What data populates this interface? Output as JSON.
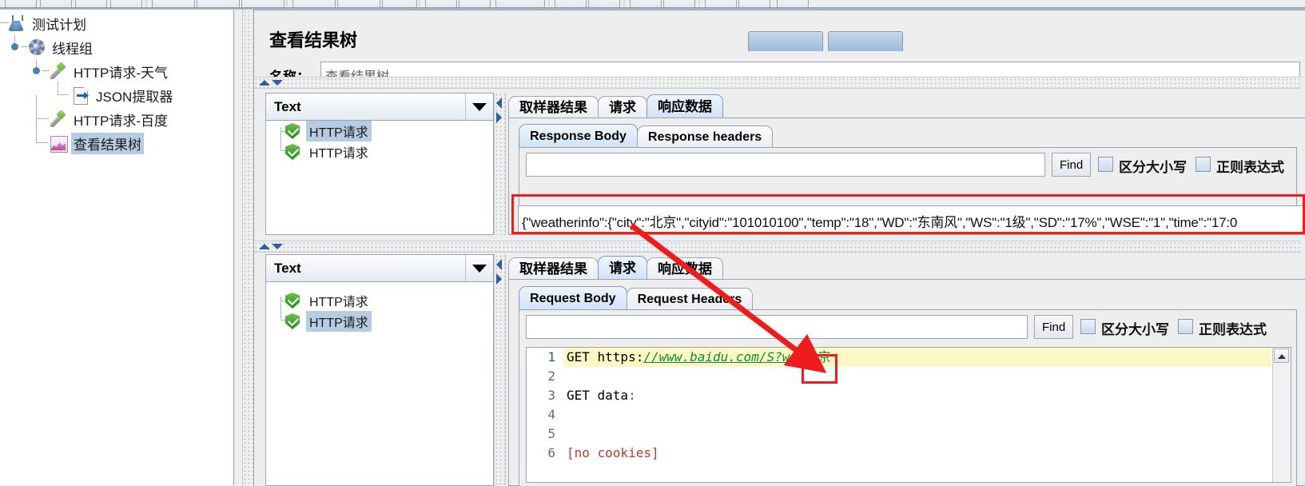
{
  "window": {
    "toolbar_note": "partially-visible-toolbar-buttons"
  },
  "tree": {
    "items": [
      {
        "label": "测试计划",
        "icon": "flask-icon",
        "depth": 0,
        "selected": false
      },
      {
        "label": "线程组",
        "icon": "gear-icon",
        "depth": 1,
        "selected": false
      },
      {
        "label": "HTTP请求-天气",
        "icon": "pipette-icon",
        "depth": 2,
        "selected": false
      },
      {
        "label": "JSON提取器",
        "icon": "document-arrow-icon",
        "depth": 3,
        "selected": false
      },
      {
        "label": "HTTP请求-百度",
        "icon": "pipette-icon",
        "depth": 2,
        "selected": false
      },
      {
        "label": "查看结果树",
        "icon": "results-chart-icon",
        "depth": 2,
        "selected": true
      }
    ]
  },
  "header": {
    "title": "查看结果树",
    "name_label": "名称：",
    "name_value": "查看结果树"
  },
  "upper_pane": {
    "render_select": "Text",
    "sampler_results": [
      {
        "label": "HTTP请求",
        "status": "success",
        "selected": true
      },
      {
        "label": "HTTP请求",
        "status": "success",
        "selected": false
      }
    ],
    "tabs": [
      {
        "label": "取样器结果",
        "active": false
      },
      {
        "label": "请求",
        "active": false
      },
      {
        "label": "响应数据",
        "active": true
      }
    ],
    "sub_tabs": [
      {
        "label": "Response Body",
        "active": true
      },
      {
        "label": "Response headers",
        "active": false
      }
    ],
    "find": {
      "query": "",
      "button_label": "Find",
      "match_case_label": "区分大小写",
      "match_case_checked": false,
      "regex_label": "正则表达式",
      "regex_checked": false
    },
    "response_body": "{\"weatherinfo\":{\"city\":\"北京\",\"cityid\":\"101010100\",\"temp\":\"18\",\"WD\":\"东南风\",\"WS\":\"1级\",\"SD\":\"17%\",\"WSE\":\"1\",\"time\":\"17:0"
  },
  "lower_pane": {
    "render_select": "Text",
    "sampler_results": [
      {
        "label": "HTTP请求",
        "status": "success",
        "selected": false
      },
      {
        "label": "HTTP请求",
        "status": "success",
        "selected": true
      }
    ],
    "tabs": [
      {
        "label": "取样器结果",
        "active": false
      },
      {
        "label": "请求",
        "active": true
      },
      {
        "label": "响应数据",
        "active": false
      }
    ],
    "sub_tabs": [
      {
        "label": "Request Body",
        "active": true
      },
      {
        "label": "Request Headers",
        "active": false
      }
    ],
    "find": {
      "query": "",
      "button_label": "Find",
      "match_case_label": "区分大小写",
      "match_case_checked": false,
      "regex_label": "正则表达式",
      "regex_checked": false
    },
    "code": {
      "line_numbers": [
        "1",
        "2",
        "3",
        "4",
        "5",
        "6"
      ],
      "lines": [
        {
          "n": "1",
          "method": "GET ",
          "scheme": "https:",
          "url": "//www.baidu.com/S?wd",
          "eq": "=",
          "param": "北京",
          "highlight": true
        },
        {
          "n": "2",
          "text": "",
          "highlight": false
        },
        {
          "n": "3",
          "text": "GET data",
          "colon": ":",
          "highlight": false
        },
        {
          "n": "4",
          "text": "",
          "highlight": false
        },
        {
          "n": "5",
          "text": "",
          "highlight": false
        },
        {
          "n": "6",
          "text": "[no cookies]",
          "highlight": false
        }
      ]
    }
  },
  "annotations": {
    "response_highlight_label": "response-body-red-box",
    "param_highlight_label": "request-param-red-box",
    "arrow_label": "correlation-arrow",
    "color": "#ee1c1c"
  },
  "colors": {
    "accent": "#2f5f9e",
    "selection": "#b6cce3",
    "highlight_row": "#fbf8c4",
    "annotation": "#ee1c1c",
    "success_green": "#1f8a22",
    "url_green": "#118a3c"
  }
}
